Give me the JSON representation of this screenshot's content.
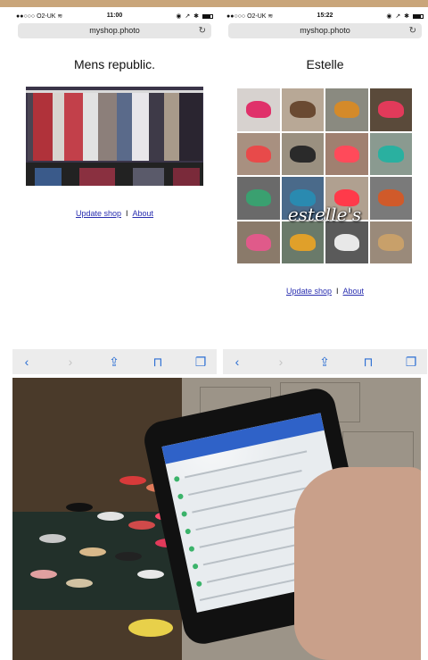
{
  "screens": [
    {
      "status": {
        "carrier": "●●○○○ O2-UK ≋",
        "time": "11:00",
        "icons": "◉ ↗ ✱"
      },
      "url": "myshop.photo",
      "title": "Mens republic.",
      "links": {
        "update": "Update shop",
        "separator": "I",
        "about": "About"
      }
    },
    {
      "status": {
        "carrier": "●●○○○ O2-UK ≋",
        "time": "15:22",
        "icons": "◉ ↗ ✱"
      },
      "url": "myshop.photo",
      "title": "Estelle",
      "logo_text": "estelle's",
      "links": {
        "update": "Update shop",
        "separator": "I",
        "about": "About"
      }
    }
  ],
  "toolbar": {
    "back": "‹",
    "forward": "›",
    "share": "⇪",
    "bookmarks": "⊓",
    "tabs": "❐"
  },
  "reload_glyph": "↻",
  "colors": {
    "link": "#2a2fb0",
    "toolbar_active": "#2d6fd3",
    "toolbar_disabled": "#c4c4c4",
    "url_bar": "#e6e6e6",
    "app_bar": "#2f62c8"
  }
}
